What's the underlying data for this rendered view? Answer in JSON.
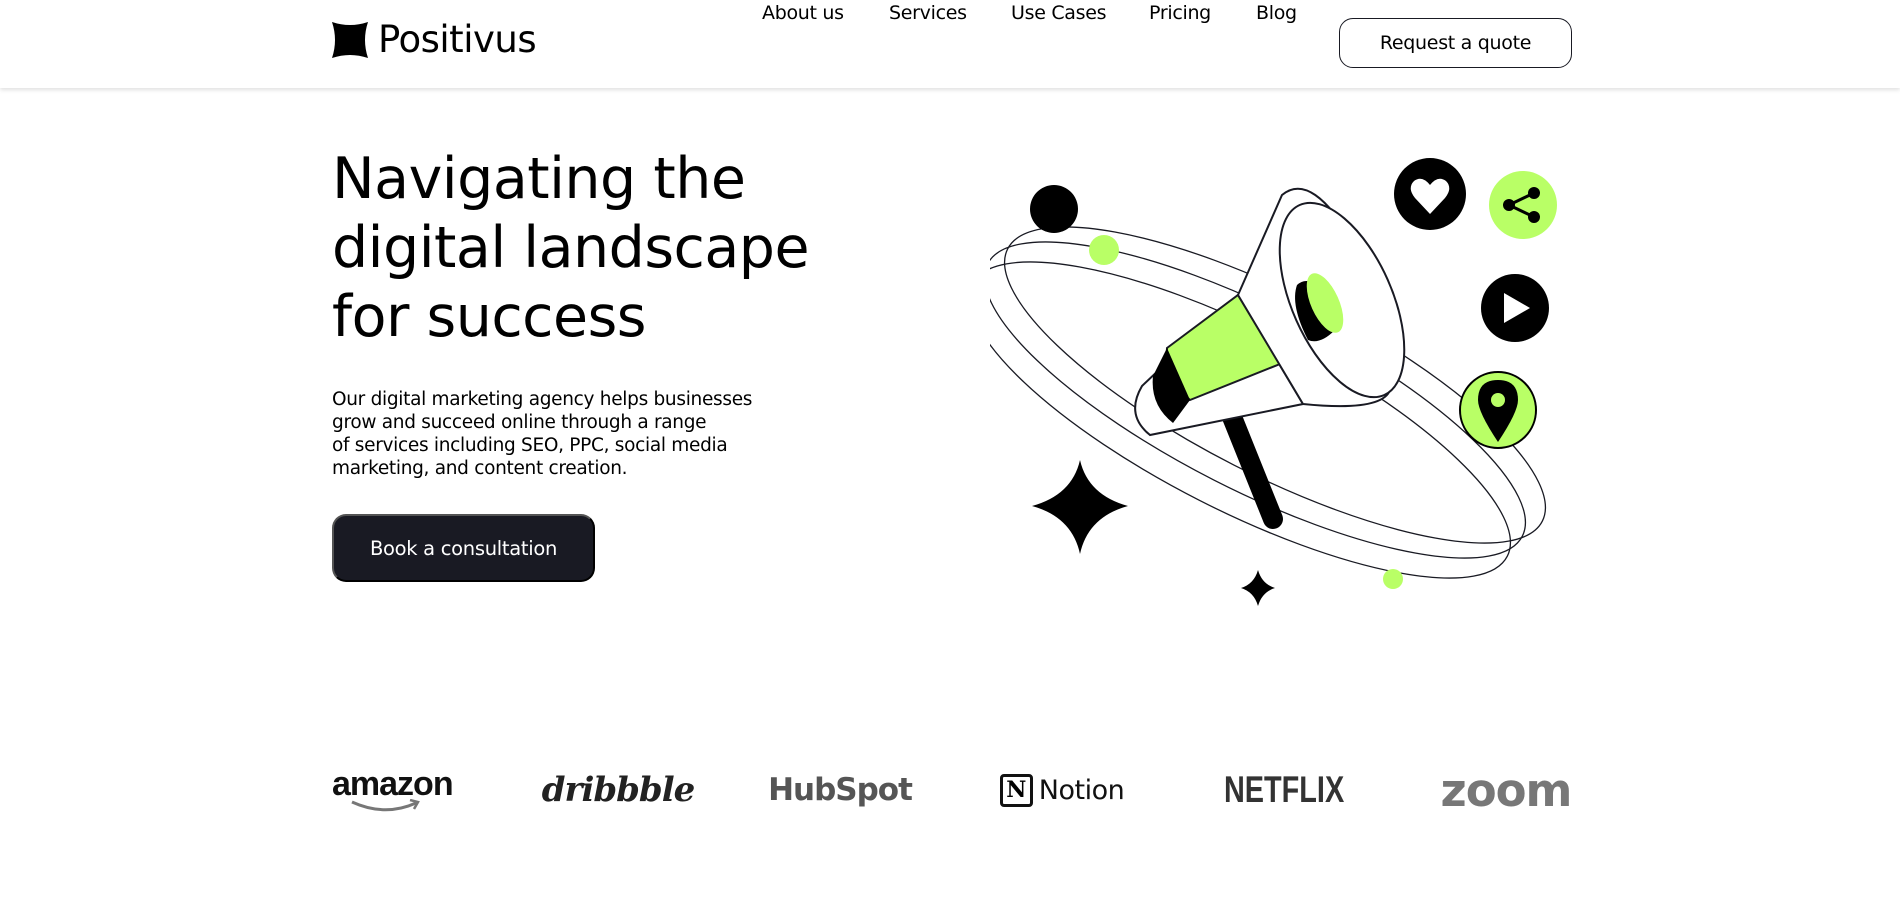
{
  "colors": {
    "accent": "#b9ff66",
    "dark": "#191a23",
    "text": "#000000"
  },
  "brand": {
    "name": "Positivus",
    "icon": "sparkle-star-icon"
  },
  "nav": {
    "items": [
      {
        "label": "About us"
      },
      {
        "label": "Services"
      },
      {
        "label": "Use Cases"
      },
      {
        "label": "Pricing"
      },
      {
        "label": "Blog"
      }
    ],
    "cta_label": "Request a quote"
  },
  "hero": {
    "title_lines": [
      "Navigating the",
      "digital landscape",
      "for success"
    ],
    "description": "Our digital marketing agency helps businesses\ngrow and succeed online through a range\nof services including SEO, PPC, social media\nmarketing, and content creation.",
    "cta_label": "Book a consultation",
    "illustration_icons": [
      "megaphone-icon",
      "heart-icon",
      "share-icon",
      "play-icon",
      "location-pin-icon",
      "sparkle-star-icon"
    ]
  },
  "clients": {
    "logos": [
      {
        "name": "amazon",
        "icon": "amazon-logo"
      },
      {
        "name": "dribbble",
        "icon": "dribbble-logo"
      },
      {
        "name": "HubSpot",
        "icon": "hubspot-logo"
      },
      {
        "name": "Notion",
        "icon": "notion-logo"
      },
      {
        "name": "NETFLIX",
        "icon": "netflix-logo"
      },
      {
        "name": "zoom",
        "icon": "zoom-logo"
      }
    ]
  }
}
